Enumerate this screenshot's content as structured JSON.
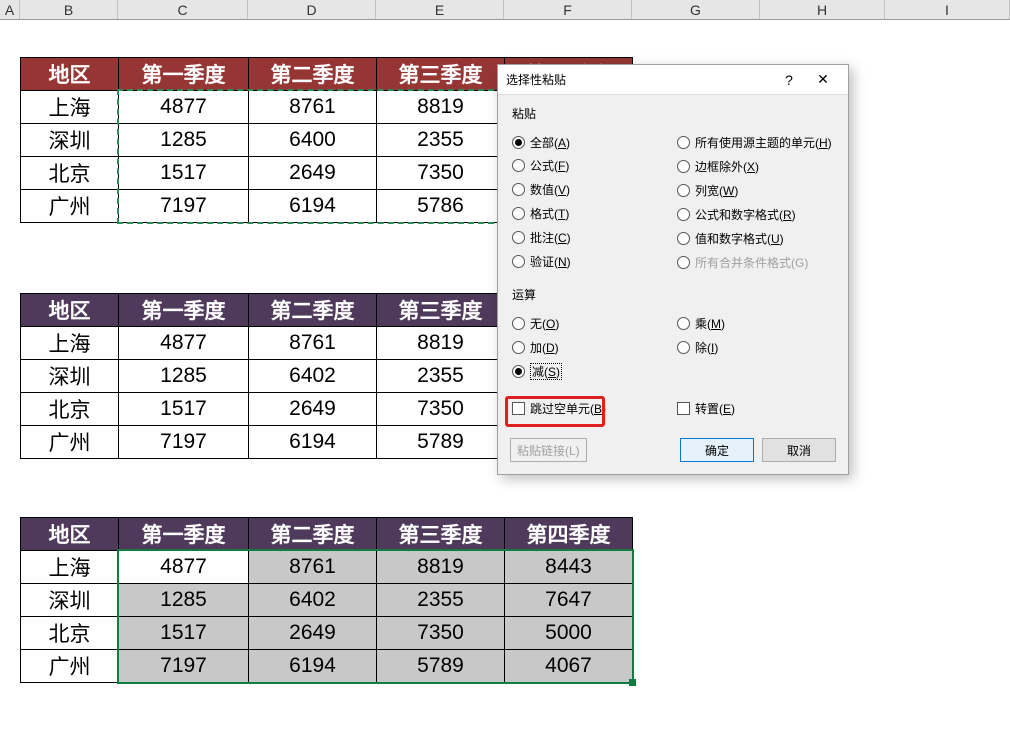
{
  "columns": [
    "A",
    "B",
    "C",
    "D",
    "E",
    "F",
    "G",
    "H",
    "I"
  ],
  "table_headers": [
    "地区",
    "第一季度",
    "第二季度",
    "第三季度",
    "第四季度"
  ],
  "table1": {
    "rows": [
      [
        "上海",
        "4877",
        "8761",
        "8819"
      ],
      [
        "深圳",
        "1285",
        "6400",
        "2355"
      ],
      [
        "北京",
        "1517",
        "2649",
        "7350"
      ],
      [
        "广州",
        "7197",
        "6194",
        "5786"
      ]
    ]
  },
  "table2": {
    "rows": [
      [
        "上海",
        "4877",
        "8761",
        "8819"
      ],
      [
        "深圳",
        "1285",
        "6402",
        "2355"
      ],
      [
        "北京",
        "1517",
        "2649",
        "7350"
      ],
      [
        "广州",
        "7197",
        "6194",
        "5789"
      ]
    ]
  },
  "table3": {
    "rows": [
      [
        "上海",
        "4877",
        "8761",
        "8819",
        "8443"
      ],
      [
        "深圳",
        "1285",
        "6402",
        "2355",
        "7647"
      ],
      [
        "北京",
        "1517",
        "2649",
        "7350",
        "5000"
      ],
      [
        "广州",
        "7197",
        "6194",
        "5789",
        "4067"
      ]
    ]
  },
  "dialog": {
    "title": "选择性粘贴",
    "help": "?",
    "close": "✕",
    "paste_label": "粘贴",
    "paste_left": [
      {
        "label": "全部",
        "key": "A",
        "checked": true
      },
      {
        "label": "公式",
        "key": "F",
        "checked": false
      },
      {
        "label": "数值",
        "key": "V",
        "checked": false
      },
      {
        "label": "格式",
        "key": "T",
        "checked": false
      },
      {
        "label": "批注",
        "key": "C",
        "checked": false
      },
      {
        "label": "验证",
        "key": "N",
        "checked": false
      }
    ],
    "paste_right": [
      {
        "label": "所有使用源主题的单元",
        "key": "H",
        "checked": false,
        "disabled": false
      },
      {
        "label": "边框除外",
        "key": "X",
        "checked": false
      },
      {
        "label": "列宽",
        "key": "W",
        "checked": false
      },
      {
        "label": "公式和数字格式",
        "key": "R",
        "checked": false
      },
      {
        "label": "值和数字格式",
        "key": "U",
        "checked": false
      },
      {
        "label": "所有合并条件格式(G)",
        "key": "",
        "checked": false,
        "disabled": true
      }
    ],
    "op_label": "运算",
    "op_left": [
      {
        "label": "无",
        "key": "O",
        "checked": false
      },
      {
        "label": "加",
        "key": "D",
        "checked": false
      },
      {
        "label": "减",
        "key": "S",
        "checked": true
      }
    ],
    "op_right": [
      {
        "label": "乘",
        "key": "M",
        "checked": false
      },
      {
        "label": "除",
        "key": "I",
        "checked": false
      }
    ],
    "skip_blanks": {
      "label": "跳过空单元",
      "key": "B",
      "checked": false
    },
    "transpose": {
      "label": "转置",
      "key": "E",
      "checked": false
    },
    "paste_link": "粘贴链接(L)",
    "ok": "确定",
    "cancel": "取消"
  }
}
